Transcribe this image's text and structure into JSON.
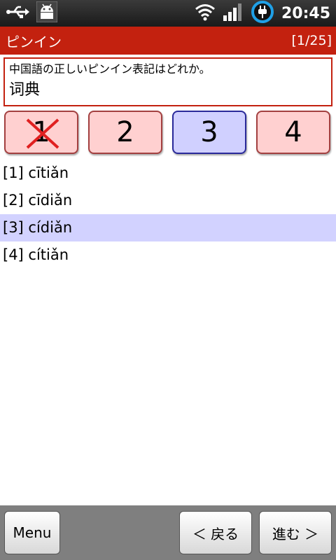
{
  "status_bar": {
    "time": "20:45",
    "icons": [
      "usb-icon",
      "android-debug-icon",
      "wifi-icon",
      "signal-icon",
      "battery-charging-icon"
    ]
  },
  "title_bar": {
    "title": "ピンイン",
    "counter": "[1/25]"
  },
  "question": {
    "prompt": "中国語の正しいピンイン表記はどれか。",
    "word": "词典"
  },
  "answer_buttons": [
    {
      "label": "1",
      "state": "wrong"
    },
    {
      "label": "2",
      "state": "normal"
    },
    {
      "label": "3",
      "state": "selected"
    },
    {
      "label": "4",
      "state": "normal"
    }
  ],
  "options": [
    {
      "text": "[1] cītiǎn",
      "highlighted": false
    },
    {
      "text": "[2] cīdiǎn",
      "highlighted": false
    },
    {
      "text": "[3] cídiǎn",
      "highlighted": true
    },
    {
      "text": "[4] cítiǎn",
      "highlighted": false
    }
  ],
  "bottom_bar": {
    "menu_label": "Menu",
    "back_label": "＜ 戻る",
    "next_label": "進む ＞"
  },
  "colors": {
    "title_bar": "#c3210f",
    "answer_button": "#ffd0d0",
    "answer_selected": "#d0d0ff",
    "highlight_row": "#d2d2ff",
    "wrong_mark": "#e02020"
  }
}
